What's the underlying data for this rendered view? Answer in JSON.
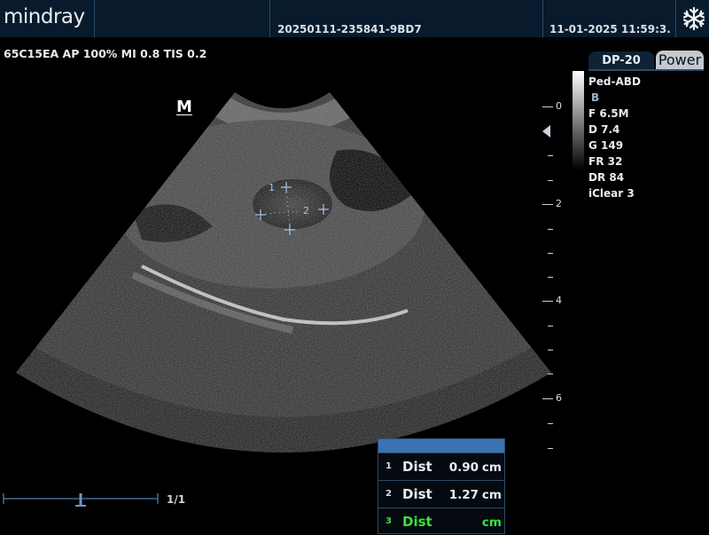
{
  "header": {
    "brand": "mindray",
    "exam_id": "20250111-235841-9BD7",
    "datetime": "11-01-2025 11:59:3..."
  },
  "imaging_params": {
    "summary": "65C15EA  AP 100%  MI 0.8  TIS 0.2"
  },
  "orientation_mark": "M",
  "depth_scale": {
    "labels": [
      "0",
      "2",
      "4",
      "6"
    ],
    "unit": "cm"
  },
  "side_panel": {
    "dp_tab": "DP-20",
    "power_tab": "Power",
    "preset": "Ped-ABD",
    "mode": "B",
    "frequency": "F 6.5M",
    "depth": "D 7.4",
    "gain": "G 149",
    "frame_rate": "FR 32",
    "dynamic_range": "DR 84",
    "iclear": "iClear 3"
  },
  "calipers": {
    "marker_1": "1",
    "marker_2": "2"
  },
  "cine": {
    "frame_count": "1/1"
  },
  "measurements": [
    {
      "index": "1",
      "label": "Dist",
      "value": "0.90",
      "unit": "cm",
      "active": false
    },
    {
      "index": "2",
      "label": "Dist",
      "value": "1.27",
      "unit": "cm",
      "active": false
    },
    {
      "index": "3",
      "label": "Dist",
      "value": "",
      "unit": "cm",
      "active": true
    }
  ],
  "colors": {
    "header_bg": "#081a2b",
    "header_border": "#2e4a66",
    "active_measure": "#3ce03c",
    "panel_header": "#3a73b4",
    "caliper": "#a9c6e6"
  },
  "icons": {
    "freeze": "snowflake-icon",
    "focus": "focus-marker-icon"
  }
}
